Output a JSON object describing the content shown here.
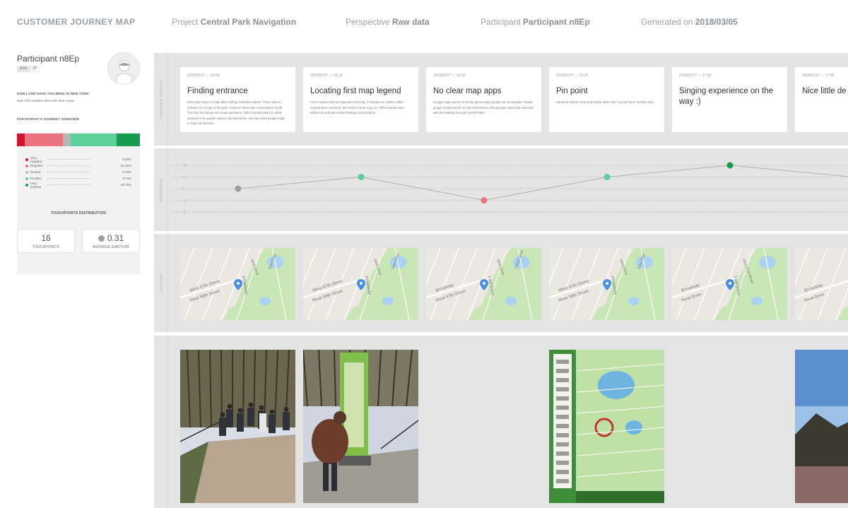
{
  "header": {
    "brand": "CUSTOMER JOURNEY MAP",
    "project_label": "Project",
    "project_value": "Central Park Navigation",
    "perspective_label": "Perspective",
    "perspective_value": "Raw data",
    "participant_label": "Participant",
    "participant_value": "Participant n8Ep",
    "generated_label": "Generated on",
    "generated_value": "2018/03/05"
  },
  "participant": {
    "name": "Participant n8Ep",
    "age_label": "AGE",
    "age_value": "27",
    "question": "HOW LONG HAVE YOU BEEN IN NEW YORK",
    "answer": "New York resident since less than a year",
    "overview_title": "PARTICIPANT'S JOURNEY OVERVIEW",
    "distribution": [
      {
        "label": "Very negative",
        "pct": "6.25%",
        "value": 0.0625,
        "color": "#d0142c"
      },
      {
        "label": "Negative",
        "pct": "31.25%",
        "value": 0.3125,
        "color": "#e9747f"
      },
      {
        "label": "Neutral",
        "pct": "6.25%",
        "value": 0.0625,
        "color": "#b5b5b5"
      },
      {
        "label": "Positive",
        "pct": "37.5%",
        "value": 0.375,
        "color": "#5dd09a"
      },
      {
        "label": "Very positive",
        "pct": "18.75%",
        "value": 0.1875,
        "color": "#169c4f"
      }
    ],
    "distribution_title": "TOUCHPOINTS DISTRIBUTION",
    "touchpoints_value": "16",
    "touchpoints_label": "TOUCHPOINTS",
    "emotion_value": "0.31",
    "emotion_label": "AVERAGE EMOTION"
  },
  "rows": {
    "journey": "CUSTOMER JOURNEY",
    "experience": "EXPERIENCE",
    "locations": "LOCATIONS",
    "photos": ""
  },
  "cards": [
    {
      "time": "2018/02/27 — 16:04",
      "title": "Finding entrance",
      "desc": "Entry was easy to locate after exiting Columbus station. There was no indicator for a map of the park. However there was a information booth. This did not intrigue me to ask questions. Other tourists relied on what seemed to be google maps to find directions. We also used google maps to map out direction"
    },
    {
      "time": "2018/02/27 — 16:13",
      "title": "Locating first map legend",
      "desc": "Line to wait to look at map was a bit long. 3 minutes vs. instant. Other tourists were confused. We found a route to go on. Other tourists were behind us and had similar feelings of uncertainty."
    },
    {
      "time": "2018/02/27 — 16:22",
      "title": "No clear map apps",
      "desc": "Google maps seems to be the general app people use to navigate. Maybe google should launch an internal function with googles maps that coincides with the walking through Central Park?"
    },
    {
      "time": "2018/02/27 — 16:25",
      "title": "Pin point",
      "desc": "Someone had to circle and notate where the \"you are here\" location was."
    },
    {
      "time": "2018/02/27 — 17:00",
      "title": "Singing experience on the way :)",
      "desc": ""
    },
    {
      "time": "2018/02/27 — 17:05",
      "title": "Nice little de",
      "desc": ""
    }
  ],
  "experience": {
    "axis_labels": [
      "+2",
      "+1",
      "0",
      "-1",
      "-2"
    ],
    "points": [
      {
        "value": 0,
        "color": "#9e9e9e"
      },
      {
        "value": 1,
        "color": "#5dd09a"
      },
      {
        "value": -1,
        "color": "#e9747f"
      },
      {
        "value": 1,
        "color": "#5dd09a"
      },
      {
        "value": 2,
        "color": "#169c4f"
      },
      {
        "value": 1,
        "color": "#5dd09a"
      }
    ]
  },
  "maps": [
    {
      "streets": [
        "West 57th Street",
        "West 59th Street",
        "Broadway",
        "West Drive",
        "East Drive"
      ]
    },
    {
      "streets": [
        "West 57th Street",
        "West 59th Street",
        "Broadway",
        "West Drive",
        "East Drive"
      ]
    },
    {
      "streets": [
        "Broadway",
        "West 57th Street",
        "East Drive",
        "West Drive",
        "Center Drive"
      ]
    },
    {
      "streets": [
        "West 57th Street",
        "West 59th Street",
        "Broadway",
        "West Drive",
        "East Drive"
      ]
    },
    {
      "streets": [
        "Broadway",
        "West Drive",
        "East Drive",
        "West 57th Street"
      ]
    },
    {
      "streets": [
        "Broadway",
        "West Drive"
      ]
    }
  ],
  "photos": [
    {
      "index": 0,
      "kind": "crowd"
    },
    {
      "index": 1,
      "kind": "map-kiosk"
    },
    {
      "index": 3,
      "kind": "park-map"
    },
    {
      "index": 5,
      "kind": "sky"
    }
  ],
  "colors": {
    "row_bg": "#e4e4e4",
    "card_bg": "#ffffff",
    "map_land": "#ebe8e1",
    "map_park": "#c9e6b7",
    "map_water": "#a9d3f0",
    "map_pin": "#4a90e2"
  }
}
